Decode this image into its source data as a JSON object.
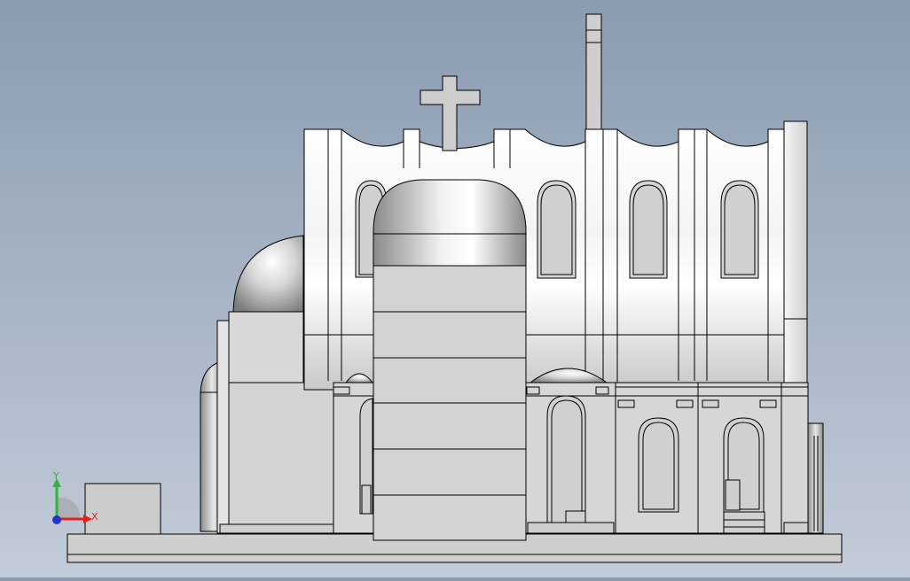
{
  "viewport": {
    "view": "front",
    "background_top": "#8b9bb0",
    "background_bottom": "#c3ccd8"
  },
  "model": {
    "name": "church model",
    "line_color": "#000000",
    "face_color": "#d9d9d9"
  },
  "triad": {
    "x_label": "X",
    "y_label": "Y",
    "x_color": "#e0241b",
    "y_color": "#2fb53a",
    "z_color": "#2633c9"
  }
}
